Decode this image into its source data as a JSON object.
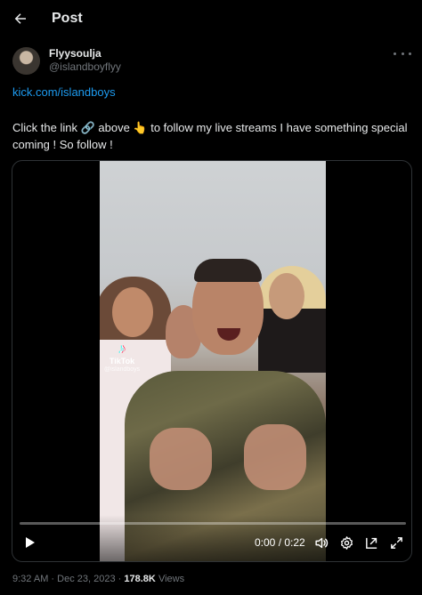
{
  "header": {
    "title": "Post",
    "back_icon": "arrow-left-icon"
  },
  "author": {
    "display_name": "Flyysoulja",
    "handle": "@islandboyflyy",
    "more_icon": "more-horizontal-icon"
  },
  "post": {
    "link_text": "kick.com/islandboys",
    "text_part1": "Click the link ",
    "emoji_link": "🔗",
    "text_part2": " above ",
    "emoji_point": "👆",
    "text_part3": " to follow my live streams I have something special coming ! So follow !"
  },
  "video": {
    "overlay_brand": "TikTok",
    "overlay_glyph": "♪",
    "overlay_handle": "@islandboys",
    "current_time": "0:00",
    "duration": "0:22",
    "time_display": "0:00 / 0:22",
    "progress_fraction": 0.0,
    "controls": {
      "play_icon": "play-icon",
      "volume_icon": "volume-icon",
      "settings_icon": "gear-icon",
      "pip_icon": "picture-in-picture-icon",
      "fullscreen_icon": "fullscreen-icon"
    }
  },
  "meta": {
    "time": "9:32 AM",
    "separator": "·",
    "date": "Dec 23, 2023",
    "views_count": "178.8K",
    "views_label": "Views"
  },
  "colors": {
    "background": "#000000",
    "text_primary": "#e7e9ea",
    "text_secondary": "#71767b",
    "accent": "#1d9bf0",
    "border": "#2f3336"
  }
}
